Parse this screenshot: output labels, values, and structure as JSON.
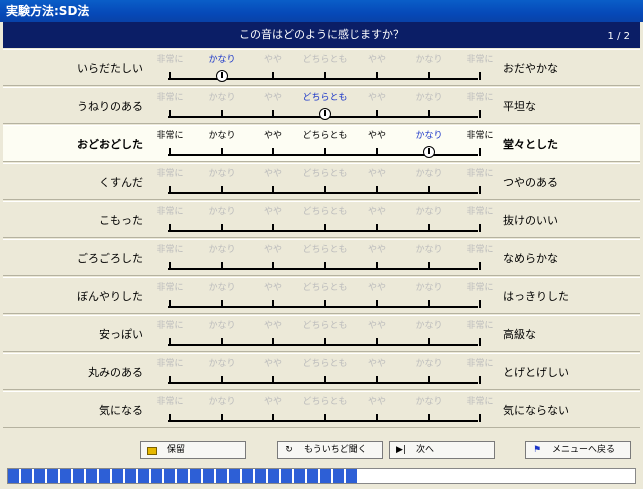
{
  "window": {
    "title": "実験方法:SD法"
  },
  "question": {
    "text": "この音はどのように感じますか？",
    "page": "1 / 2"
  },
  "scale_labels": [
    "非常に",
    "かなり",
    "やや",
    "どちらとも",
    "やや",
    "かなり",
    "非常に"
  ],
  "rows": [
    {
      "left": "いらだたしい",
      "right": "おだやかな",
      "selected": 1,
      "active": false
    },
    {
      "left": "うねりのある",
      "right": "平坦な",
      "selected": 3,
      "active": false
    },
    {
      "left": "おどおどした",
      "right": "堂々とした",
      "selected": 5,
      "active": true
    },
    {
      "left": "くすんだ",
      "right": "つやのある",
      "selected": -1,
      "active": false
    },
    {
      "left": "こもった",
      "right": "抜けのいい",
      "selected": -1,
      "active": false
    },
    {
      "left": "ごろごろした",
      "right": "なめらかな",
      "selected": -1,
      "active": false
    },
    {
      "left": "ぼんやりした",
      "right": "はっきりした",
      "selected": -1,
      "active": false
    },
    {
      "left": "安っぽい",
      "right": "高級な",
      "selected": -1,
      "active": false
    },
    {
      "left": "丸みのある",
      "right": "とげとげしい",
      "selected": -1,
      "active": false
    },
    {
      "left": "気になる",
      "right": "気にならない",
      "selected": -1,
      "active": false
    }
  ],
  "buttons": {
    "hold": "保留",
    "replay": "もういちど聞く",
    "next": "次へ",
    "menu": "メニューへ戻る"
  },
  "icons": {
    "hold": "folder-icon",
    "replay": "replay-icon",
    "next": "next-icon",
    "menu": "return-flag-icon"
  },
  "progress": {
    "segments": 27
  },
  "colors": {
    "selected": "#1a35c8",
    "question_bar": "#0b1e66",
    "progress": "#2d5fd6"
  }
}
